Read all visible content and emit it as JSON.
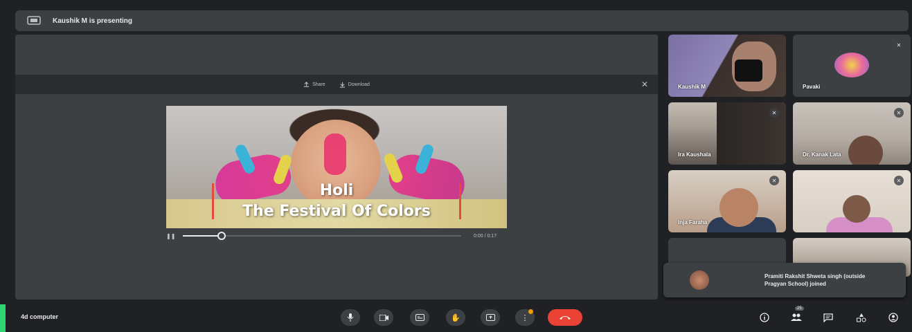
{
  "header": {
    "presenting_text": "Kaushik M is presenting"
  },
  "stage": {
    "toolbar": {
      "share_label": "Share",
      "download_label": "Download"
    },
    "slide": {
      "title_line1": "Holi",
      "title_line2": "The Festival Of Colors"
    },
    "player": {
      "time": "0:00 / 0:17",
      "progress": 0.14
    }
  },
  "participants": [
    {
      "name": "Kaushik M"
    },
    {
      "name": "Pavaki"
    },
    {
      "name": "Ira Kaushala"
    },
    {
      "name": "Dr. Kanak Lata"
    },
    {
      "name": "Inja Faraha"
    },
    {
      "name": ""
    }
  ],
  "toast": {
    "message": "Pramiti Rakshit Shweta singh (outside Pragyan School) joined"
  },
  "footer": {
    "meeting_name": "4d computer",
    "people_count": "25"
  },
  "colors": {
    "end_call": "#ea4335",
    "background": "#202124",
    "surface": "#3c4043"
  }
}
